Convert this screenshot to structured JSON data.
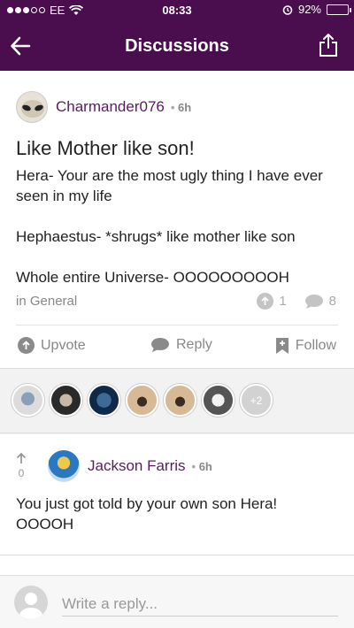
{
  "status": {
    "carrier": "EE",
    "time": "08:33",
    "battery": "92%",
    "battery_level": 0.92
  },
  "nav": {
    "title": "Discussions"
  },
  "post": {
    "author": "Charmander076",
    "time_ago": "6h",
    "title": "Like Mother like son!",
    "body": [
      "Hera- Your are the most ugly thing I have ever seen in my life",
      "Hephaestus- *shrugs* like mother like son",
      "Whole entire Universe- OOOOOOOOOH"
    ],
    "category": "in General",
    "upvotes": "1",
    "replies": "8"
  },
  "actions": {
    "upvote": "Upvote",
    "reply": "Reply",
    "follow": "Follow"
  },
  "participants": {
    "more": "+2"
  },
  "comment": {
    "vote_count": "0",
    "author": "Jackson Farris",
    "time_ago": "6h",
    "text": "You just got told by your own son Hera! OOOOH"
  },
  "reply_bar": {
    "placeholder": "Write a reply..."
  }
}
